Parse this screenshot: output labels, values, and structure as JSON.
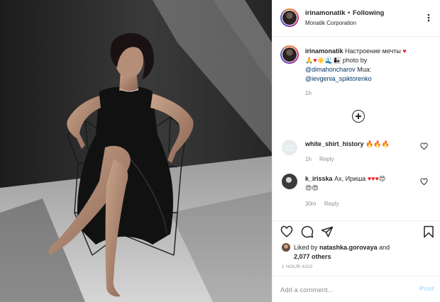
{
  "header": {
    "username": "irinamonatik",
    "separator": "•",
    "follow_status": "Following",
    "location": "Monatik Corporation"
  },
  "caption": {
    "username": "irinamonatik",
    "text_1": "Настроение мечты",
    "text_2": "photo by",
    "mention_1": "@dimahoncharov",
    "text_3": "Mua:",
    "mention_2": "@ievgenia_spiktorenko",
    "time": "1h"
  },
  "comments": [
    {
      "username": "white_shirt_history",
      "avatar_text": "WHITE SHIRT",
      "time": "1h",
      "reply_label": "Reply"
    },
    {
      "username": "k_irisska",
      "text": "Ах, Ириша",
      "time": "30m",
      "reply_label": "Reply"
    }
  ],
  "likes": {
    "prefix": "Liked by",
    "username": "natashka.gorovaya",
    "connector": "and",
    "others": "2,077 others"
  },
  "post_time": "1 HOUR AGO",
  "add_comment": {
    "placeholder": "Add a comment...",
    "post_label": "Post"
  },
  "icons": {
    "more": "more-horizontal-icon",
    "load_more": "plus-circle-icon",
    "like": "heart-icon",
    "comment": "comment-icon",
    "share": "send-icon",
    "save": "bookmark-icon"
  },
  "colors": {
    "mention": "#00376b",
    "muted": "#8e8e8e",
    "heart": "#ed1c24",
    "post_button": "#b2dffc"
  }
}
